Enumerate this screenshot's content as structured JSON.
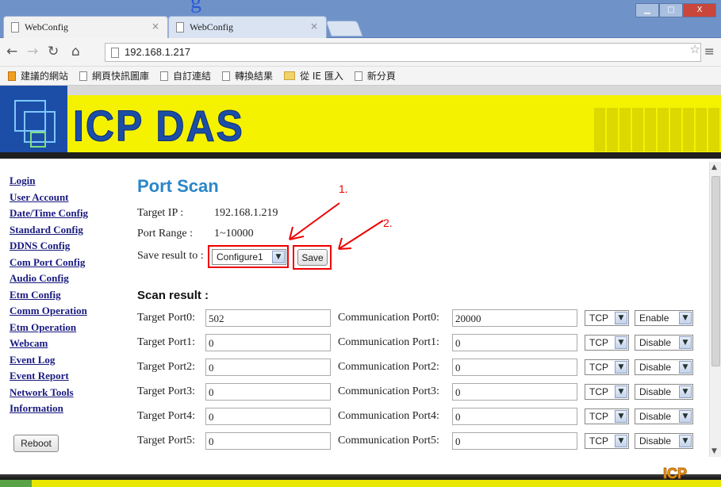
{
  "overlay_text": "g    ",
  "browser": {
    "tabs": [
      {
        "label": "WebConfig"
      },
      {
        "label": "WebConfig"
      }
    ],
    "tab_close": "×",
    "window_buttons": {
      "minimize": "▁",
      "maximize": "□",
      "close": "X"
    },
    "url": "192.168.1.217",
    "bookmarks": [
      "建議的網站",
      "網頁快訊圖庫",
      "自訂連結",
      "轉換結果",
      "從 IE 匯入",
      "新分頁"
    ]
  },
  "banner": {
    "logo_text": "ICP DAS"
  },
  "sidebar": {
    "items": [
      "Login",
      "User Account",
      "Date/Time Config",
      "Standard Config",
      "DDNS Config",
      "Com Port Config",
      "Audio Config",
      "Etm Config",
      "Comm Operation",
      "Etm Operation",
      "Webcam",
      "Event Log",
      "Event Report",
      "Network Tools",
      "Information"
    ],
    "reboot_label": "Reboot"
  },
  "page": {
    "title": "Port Scan",
    "target_ip_label": "Target IP :",
    "target_ip_value": "192.168.1.219",
    "port_range_label": "Port Range :",
    "port_range_value": "1~10000",
    "save_result_label": "Save result to :",
    "save_result_select": "Configure1",
    "save_label": "Save",
    "scan_result_heading": "Scan result :",
    "annotations": [
      "1.",
      "2."
    ]
  },
  "scan_rows": [
    {
      "target_label": "Target Port0:",
      "target_value": "502",
      "comm_label": "Communication Port0:",
      "comm_value": "20000",
      "protocol": "TCP",
      "status": "Enable"
    },
    {
      "target_label": "Target Port1:",
      "target_value": "0",
      "comm_label": "Communication Port1:",
      "comm_value": "0",
      "protocol": "TCP",
      "status": "Disable"
    },
    {
      "target_label": "Target Port2:",
      "target_value": "0",
      "comm_label": "Communication Port2:",
      "comm_value": "0",
      "protocol": "TCP",
      "status": "Disable"
    },
    {
      "target_label": "Target Port3:",
      "target_value": "0",
      "comm_label": "Communication Port3:",
      "comm_value": "0",
      "protocol": "TCP",
      "status": "Disable"
    },
    {
      "target_label": "Target Port4:",
      "target_value": "0",
      "comm_label": "Communication Port4:",
      "comm_value": "0",
      "protocol": "TCP",
      "status": "Disable"
    },
    {
      "target_label": "Target Port5:",
      "target_value": "0",
      "comm_label": "Communication Port5:",
      "comm_value": "0",
      "protocol": "TCP",
      "status": "Disable"
    }
  ],
  "footer": {
    "logo_text": "ICP"
  },
  "colors": {
    "accent": "#2a86c8",
    "link": "#1a1a80",
    "annotation": "#e00000",
    "banner_yellow": "#f5f200",
    "banner_blue": "#1c4ea8"
  }
}
